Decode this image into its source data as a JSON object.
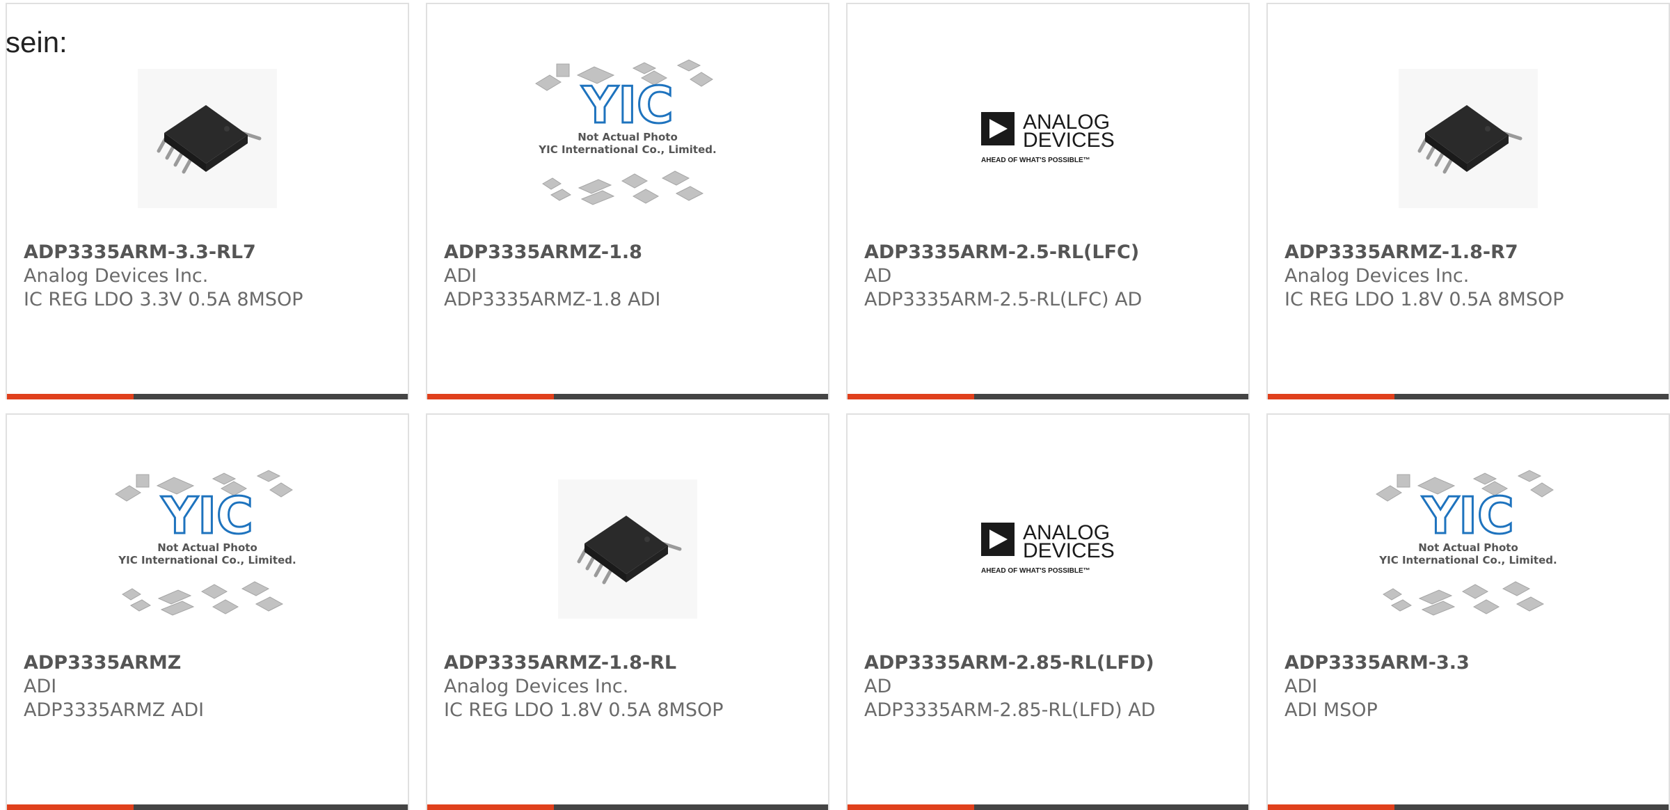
{
  "intro_text": "sein:",
  "colors": {
    "accent": "#e0401c",
    "bar": "#444444"
  },
  "cards": [
    {
      "part": "ADP3335ARM-3.3-RL7",
      "maker": "Analog Devices Inc.",
      "desc": "IC REG LDO 3.3V 0.5A 8MSOP",
      "image": "chip-photo"
    },
    {
      "part": "ADP3335ARMZ-1.8",
      "maker": "ADI",
      "desc": "ADP3335ARMZ-1.8 ADI",
      "image": "yic-placeholder"
    },
    {
      "part": "ADP3335ARM-2.5-RL(LFC)",
      "maker": "AD",
      "desc": "ADP3335ARM-2.5-RL(LFC) AD",
      "image": "analog-devices-logo"
    },
    {
      "part": "ADP3335ARMZ-1.8-R7",
      "maker": "Analog Devices Inc.",
      "desc": "IC REG LDO 1.8V 0.5A 8MSOP",
      "image": "chip-photo"
    },
    {
      "part": "ADP3335ARMZ",
      "maker": "ADI",
      "desc": "ADP3335ARMZ ADI",
      "image": "yic-placeholder"
    },
    {
      "part": "ADP3335ARMZ-1.8-RL",
      "maker": "Analog Devices Inc.",
      "desc": "IC REG LDO 1.8V 0.5A 8MSOP",
      "image": "chip-photo"
    },
    {
      "part": "ADP3335ARM-2.85-RL(LFD)",
      "maker": "AD",
      "desc": "ADP3335ARM-2.85-RL(LFD) AD",
      "image": "analog-devices-logo"
    },
    {
      "part": "ADP3335ARM-3.3",
      "maker": "ADI",
      "desc": "ADI MSOP",
      "image": "yic-placeholder"
    }
  ],
  "yic": {
    "caption_line1": "Not Actual Photo",
    "caption_line2": "YIC International Co., Limited."
  },
  "adi_logo": {
    "line1": "ANALOG",
    "line2": "DEVICES",
    "tagline": "AHEAD OF WHAT'S POSSIBLE™"
  }
}
